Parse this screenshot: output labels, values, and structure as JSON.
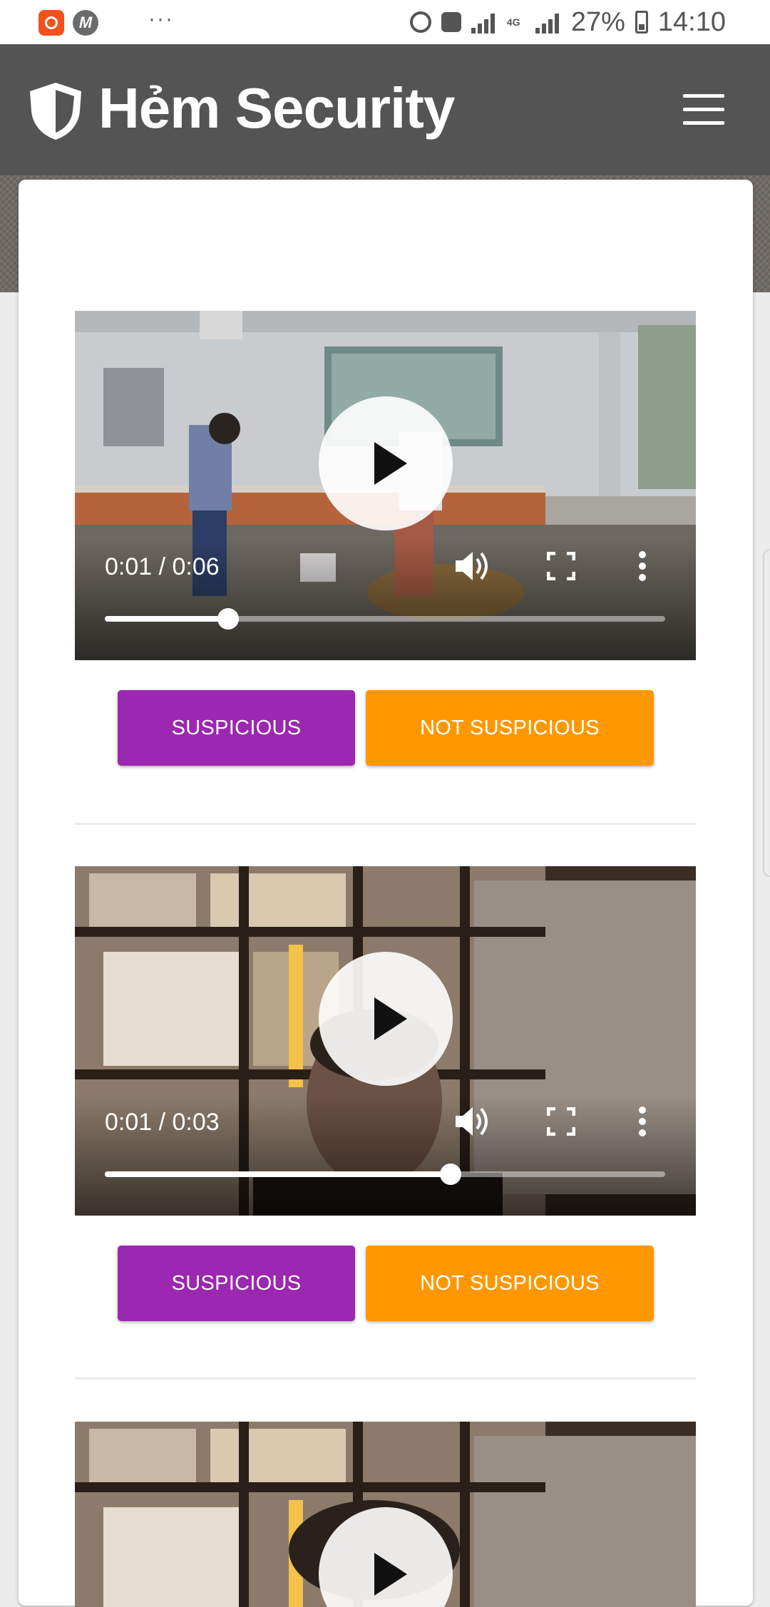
{
  "status_bar": {
    "dots": "···",
    "network": "4G",
    "battery": "27%",
    "time": "14:10"
  },
  "header": {
    "title": "Hẻm Security",
    "icons": {
      "logo": "shield-icon",
      "menu": "hamburger-menu-icon"
    }
  },
  "colors": {
    "header_bg": "#545454",
    "suspicious": "#9c27b0",
    "not_suspicious": "#ff9800"
  },
  "videos": [
    {
      "time": "0:01 / 0:06",
      "progress": 0.22,
      "buttons": {
        "suspicious": "SUSPICIOUS",
        "not_suspicious": "NOT SUSPICIOUS"
      }
    },
    {
      "time": "0:01 / 0:03",
      "progress": 0.617,
      "buttons": {
        "suspicious": "SUSPICIOUS",
        "not_suspicious": "NOT SUSPICIOUS"
      }
    },
    {
      "time": "",
      "progress": null
    }
  ]
}
